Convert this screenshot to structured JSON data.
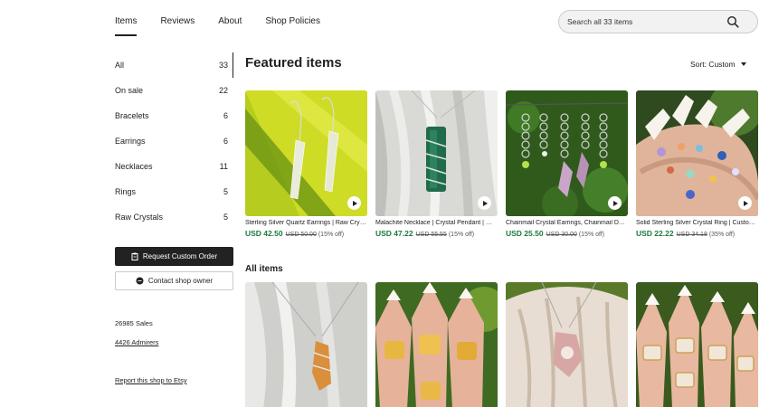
{
  "nav": {
    "tabs": [
      "Items",
      "Reviews",
      "About",
      "Shop Policies"
    ],
    "active_tab": "Items"
  },
  "search": {
    "placeholder": "Search all 33 items"
  },
  "sidebar": {
    "categories": [
      {
        "label": "All",
        "count": "33"
      },
      {
        "label": "On sale",
        "count": "22"
      },
      {
        "label": "Bracelets",
        "count": "6"
      },
      {
        "label": "Earrings",
        "count": "6"
      },
      {
        "label": "Necklaces",
        "count": "11"
      },
      {
        "label": "Rings",
        "count": "5"
      },
      {
        "label": "Raw Crystals",
        "count": "5"
      }
    ],
    "request_button": "Request Custom Order",
    "contact_button": "Contact shop owner",
    "sales": "26985 Sales",
    "admirers": "4426 Admirers",
    "report": "Report this shop to Etsy"
  },
  "main": {
    "featured_title": "Featured items",
    "sort_label": "Sort: Custom",
    "all_items_title": "All items",
    "featured": [
      {
        "title": "Sterling Silver Quartz Earrings | Raw Crystal Earrings",
        "price": "USD 42.50",
        "old_price": "USD 50.00",
        "discount": "(15% off)"
      },
      {
        "title": "Malachite Necklace | Crystal Pendant | Wire Wrapped",
        "price": "USD 47.22",
        "old_price": "USD 55.55",
        "discount": "(15% off)"
      },
      {
        "title": "Chainmail Crystal Earrings, Chainmail Dangle Earrings",
        "price": "USD 25.50",
        "old_price": "USD 30.00",
        "discount": "(15% off)"
      },
      {
        "title": "Solid Sterling Silver Crystal Ring | Custom Crystal",
        "price": "USD 22.22",
        "old_price": "USD 34.18",
        "discount": "(35% off)"
      }
    ]
  },
  "colors": {
    "price_green": "#1a7a3c",
    "dark_button": "#222222"
  }
}
